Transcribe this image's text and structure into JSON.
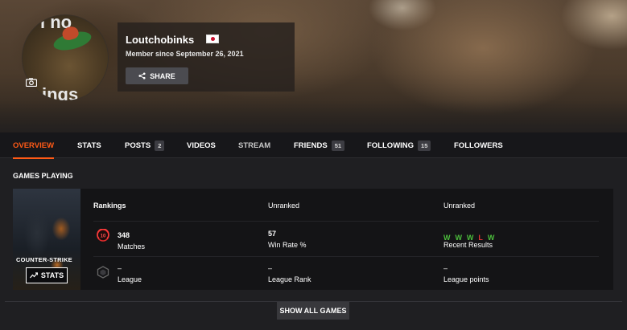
{
  "profile": {
    "username": "Loutchobinks",
    "member_since": "Member since September 26, 2021",
    "share_label": "SHARE",
    "avatar_text_top": "l no",
    "avatar_text_bottom": "ings",
    "flag": "japan-flag-icon"
  },
  "nav": {
    "tabs": [
      {
        "label": "OVERVIEW",
        "active": true
      },
      {
        "label": "STATS"
      },
      {
        "label": "POSTS",
        "count": "2"
      },
      {
        "label": "VIDEOS"
      },
      {
        "label": "STREAM"
      },
      {
        "label": "FRIENDS",
        "count": "51"
      },
      {
        "label": "FOLLOWING",
        "count": "15"
      },
      {
        "label": "FOLLOWERS"
      }
    ]
  },
  "games": {
    "section_title": "GAMES PLAYING",
    "game": {
      "cover_logo": "COUNTER-STRIKE",
      "stats_button": "STATS",
      "rankings_label": "Rankings",
      "ranking_1": "Unranked",
      "ranking_2": "Unranked",
      "badge_level": "10",
      "matches_value": "348",
      "matches_label": "Matches",
      "win_rate_value": "57",
      "win_rate_label": "Win Rate %",
      "recent_results": [
        "W",
        "W",
        "W",
        "L",
        "W"
      ],
      "recent_results_label": "Recent Results",
      "league_value": "–",
      "league_label": "League",
      "league_rank_value": "–",
      "league_rank_label": "League Rank",
      "league_points_value": "–",
      "league_points_label": "League points"
    },
    "show_all_label": "SHOW ALL GAMES"
  },
  "colors": {
    "accent": "#ff5a16",
    "win": "#4cbf3c",
    "loss": "#e03434",
    "background": "#1f1f22"
  }
}
